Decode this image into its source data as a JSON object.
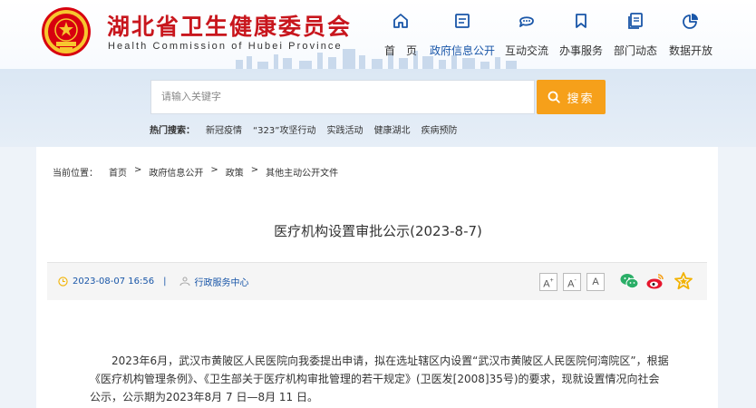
{
  "site": {
    "title": "湖北省卫生健康委员会",
    "subtitle": "Health Commission of Hubei Province"
  },
  "nav": {
    "items": [
      {
        "label": "首　页",
        "icon": "home-icon"
      },
      {
        "label": "政府信息公开",
        "icon": "document-icon",
        "active": true
      },
      {
        "label": "互动交流",
        "icon": "chat-icon"
      },
      {
        "label": "办事服务",
        "icon": "bookmark-icon"
      },
      {
        "label": "部门动态",
        "icon": "files-icon"
      },
      {
        "label": "数据开放",
        "icon": "pie-chart-icon"
      }
    ]
  },
  "search": {
    "placeholder": "请输入关键字",
    "button_label": "搜索",
    "hot_label": "热门搜索：",
    "hot_terms": [
      "新冠疫情",
      "“323”攻坚行动",
      "实践活动",
      "健康湖北",
      "疾病预防"
    ]
  },
  "breadcrumb": {
    "label": "当前位置：",
    "items": [
      "首页",
      "政府信息公开",
      "政策",
      "其他主动公开文件"
    ],
    "separator": ">"
  },
  "article": {
    "title": "医疗机构设置审批公示(2023-8-7)",
    "datetime": "2023-08-07 16:56",
    "divider": "|",
    "source": "行政服务中心",
    "font_sizes": [
      "A",
      "A",
      "A"
    ],
    "paragraph": "2023年6月，武汉市黄陂区人民医院向我委提出申请，拟在选址辖区内设置“武汉市黄陂区人民医院何湾院区”，根据《医疗机构管理条例》、《卫生部关于医疗机构审批管理的若干规定》(卫医发[2008]35号)的要求，现就设置情况向社会公示，公示期为2023年8月 7 日—8月 11 日。"
  },
  "colors": {
    "brand_red": "#c8161d",
    "nav_blue": "#1956a8",
    "search_orange": "#f6a01a",
    "wechat_green": "#2aae67",
    "weibo_orange": "#e6162d",
    "star_yellow": "#f2b200"
  }
}
